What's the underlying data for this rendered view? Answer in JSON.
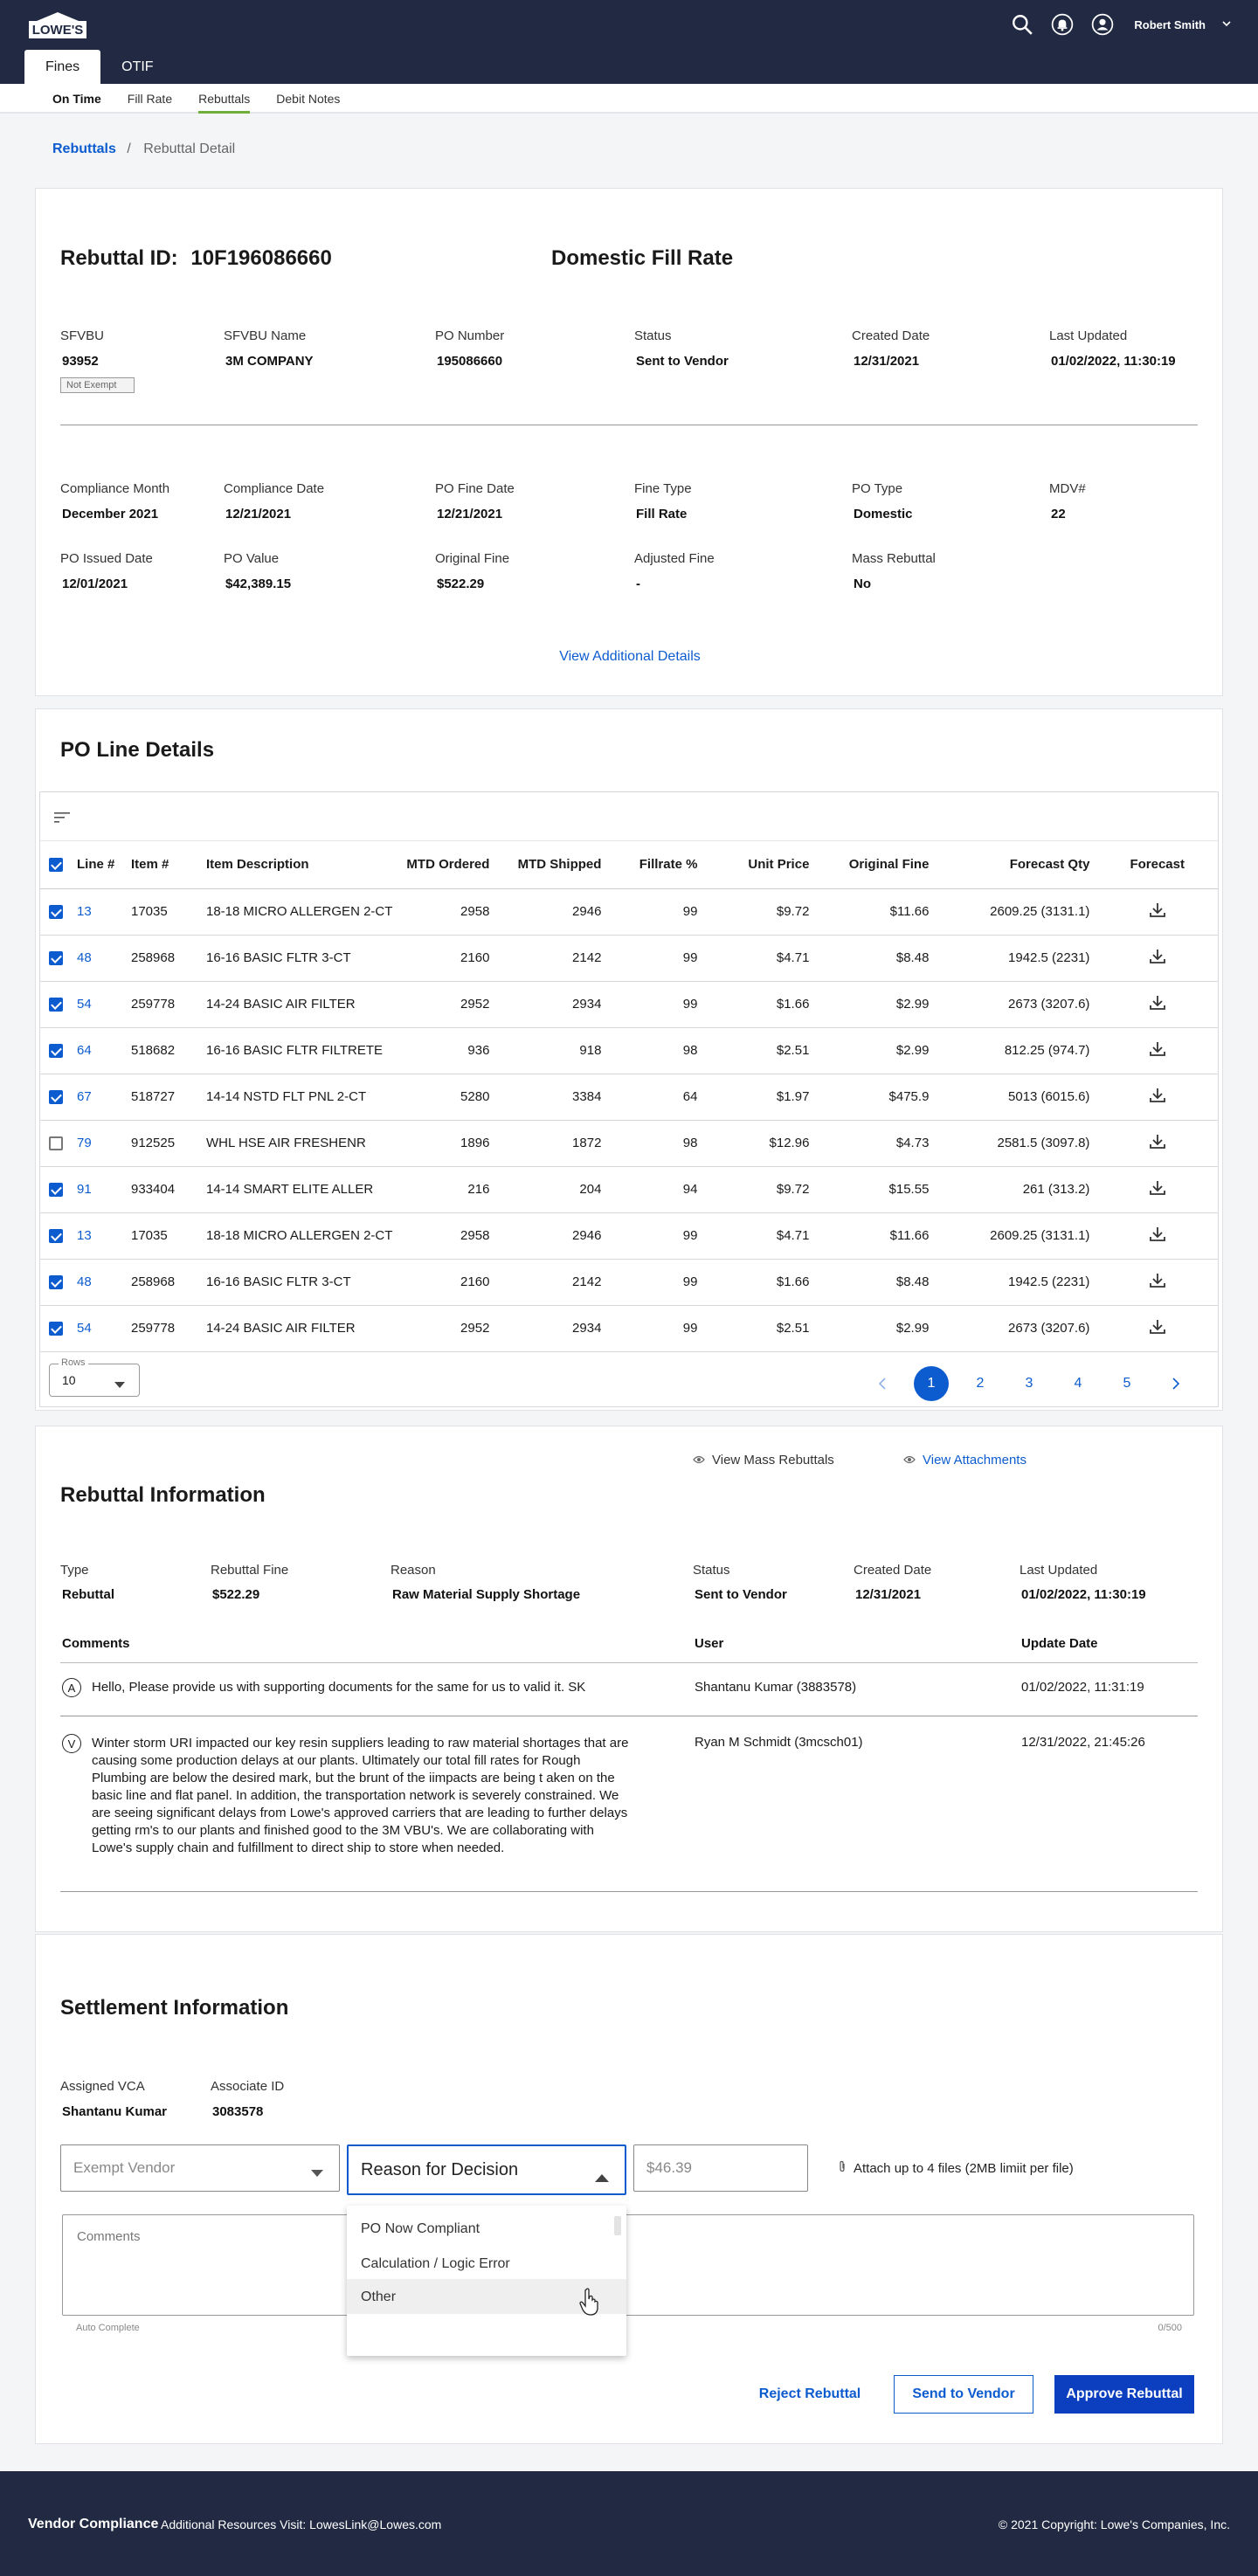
{
  "header": {
    "logo_text": "LOWE'S",
    "user_name": "Robert Smith",
    "tabs": [
      {
        "label": "Fines",
        "active": true
      },
      {
        "label": "OTIF",
        "active": false
      }
    ]
  },
  "subnav": [
    "On Time",
    "Fill Rate",
    "Rebuttals",
    "Debit Notes"
  ],
  "breadcrumb": {
    "root": "Rebuttals",
    "sep": "/",
    "current": "Rebuttal Detail"
  },
  "detail": {
    "id_label": "Rebuttal ID:",
    "id_value": "10F196086660",
    "type_title": "Domestic Fill Rate",
    "row1": [
      {
        "label": "SFVBU",
        "value": "93952"
      },
      {
        "label": "SFVBU Name",
        "value": "3M COMPANY"
      },
      {
        "label": "PO Number",
        "value": "195086660"
      },
      {
        "label": "Status",
        "value": "Sent to Vendor"
      },
      {
        "label": "Created Date",
        "value": "12/31/2021"
      },
      {
        "label": "Last Updated",
        "value": "01/02/2022, 11:30:19"
      }
    ],
    "exempt_chip": "Not Exempt",
    "row2": [
      {
        "label": "Compliance Month",
        "value": "December 2021"
      },
      {
        "label": "Compliance Date",
        "value": "12/21/2021"
      },
      {
        "label": "PO Fine Date",
        "value": "12/21/2021"
      },
      {
        "label": "Fine Type",
        "value": "Fill Rate"
      },
      {
        "label": "PO Type",
        "value": "Domestic"
      },
      {
        "label": "MDV#",
        "value": "22"
      }
    ],
    "row3": [
      {
        "label": "PO Issued Date",
        "value": "12/01/2021"
      },
      {
        "label": "PO Value",
        "value": "$42,389.15"
      },
      {
        "label": "Original Fine",
        "value": "$522.29"
      },
      {
        "label": "Adjusted Fine",
        "value": "-"
      },
      {
        "label": "Mass Rebuttal",
        "value": "No"
      }
    ],
    "view_more": "View Additional Details"
  },
  "po_lines": {
    "title": "PO Line Details",
    "columns": [
      "Line #",
      "Item #",
      "Item Description",
      "MTD Ordered",
      "MTD Shipped",
      "Fillrate %",
      "Unit Price",
      "Original Fine",
      "Forecast Qty",
      "Forecast"
    ],
    "rows": [
      {
        "checked": true,
        "line": "13",
        "item": "17035",
        "desc": "18-18 MICRO ALLERGEN 2-CT",
        "ordered": "2958",
        "shipped": "2946",
        "fill": "99",
        "price": "$9.72",
        "fine": "$11.66",
        "fq": "2609.25 (3131.1)"
      },
      {
        "checked": true,
        "line": "48",
        "item": "258968",
        "desc": "16-16 BASIC FLTR 3-CT",
        "ordered": "2160",
        "shipped": "2142",
        "fill": "99",
        "price": "$4.71",
        "fine": "$8.48",
        "fq": "1942.5 (2231)"
      },
      {
        "checked": true,
        "line": "54",
        "item": "259778",
        "desc": "14-24 BASIC AIR FILTER",
        "ordered": "2952",
        "shipped": "2934",
        "fill": "99",
        "price": "$1.66",
        "fine": "$2.99",
        "fq": "2673 (3207.6)"
      },
      {
        "checked": true,
        "line": "64",
        "item": "518682",
        "desc": "16-16 BASIC FLTR FILTRETE",
        "ordered": "936",
        "shipped": "918",
        "fill": "98",
        "price": "$2.51",
        "fine": "$2.99",
        "fq": "812.25 (974.7)"
      },
      {
        "checked": true,
        "line": "67",
        "item": "518727",
        "desc": "14-14 NSTD FLT PNL 2-CT",
        "ordered": "5280",
        "shipped": "3384",
        "fill": "64",
        "price": "$1.97",
        "fine": "$475.9",
        "fq": "5013 (6015.6)"
      },
      {
        "checked": false,
        "line": "79",
        "item": "912525",
        "desc": "WHL HSE AIR FRESHENR",
        "ordered": "1896",
        "shipped": "1872",
        "fill": "98",
        "price": "$12.96",
        "fine": "$4.73",
        "fq": "2581.5 (3097.8)"
      },
      {
        "checked": true,
        "line": "91",
        "item": "933404",
        "desc": "14-14 SMART ELITE ALLER",
        "ordered": "216",
        "shipped": "204",
        "fill": "94",
        "price": "$9.72",
        "fine": "$15.55",
        "fq": "261 (313.2)"
      },
      {
        "checked": true,
        "line": "13",
        "item": "17035",
        "desc": "18-18 MICRO ALLERGEN 2-CT",
        "ordered": "2958",
        "shipped": "2946",
        "fill": "99",
        "price": "$4.71",
        "fine": "$11.66",
        "fq": "2609.25 (3131.1)"
      },
      {
        "checked": true,
        "line": "48",
        "item": "258968",
        "desc": "16-16 BASIC FLTR 3-CT",
        "ordered": "2160",
        "shipped": "2142",
        "fill": "99",
        "price": "$1.66",
        "fine": "$8.48",
        "fq": "1942.5 (2231)"
      },
      {
        "checked": true,
        "line": "54",
        "item": "259778",
        "desc": "14-24 BASIC AIR FILTER",
        "ordered": "2952",
        "shipped": "2934",
        "fill": "99",
        "price": "$2.51",
        "fine": "$2.99",
        "fq": "2673 (3207.6)"
      }
    ],
    "rows_label": "Rows",
    "rows_value": "10",
    "pages": [
      "1",
      "2",
      "3",
      "4",
      "5"
    ],
    "current_page": "1"
  },
  "rebuttal": {
    "title": "Rebuttal Information",
    "view_mass": "View Mass Rebuttals",
    "view_attach": "View Attachments",
    "fields": [
      {
        "label": "Type",
        "value": "Rebuttal"
      },
      {
        "label": "Rebuttal Fine",
        "value": "$522.29"
      },
      {
        "label": "Reason",
        "value": "Raw Material Supply Shortage"
      },
      {
        "label": "Status",
        "value": "Sent to Vendor"
      },
      {
        "label": "Created Date",
        "value": "12/31/2021"
      },
      {
        "label": "Last Updated",
        "value": "01/02/2022, 11:30:19"
      }
    ],
    "comment_headers": [
      "Comments",
      "User",
      "Update Date"
    ],
    "comments": [
      {
        "avatar": "A",
        "text": "Hello, Please provide us with supporting documents for the same for us to valid it.  SK",
        "user": "Shantanu Kumar (3883578)",
        "date": "01/02/2022, 11:31:19"
      },
      {
        "avatar": "V",
        "text": "Winter storm URI impacted our key resin suppliers leading to raw material shortages that are causing some production delays at our plants.  Ultimately our total fill rates for Rough Plumbing are below the desired mark, but the brunt of the iimpacts are being t aken on the basic line and flat panel.  In addition, the transportation network is severely constrained.  We are seeing significant delays from Lowe's approved carriers that are leading to further delays getting rm's to our plants and finished good to the 3M VBU's.  We are collaborating with Lowe's supply chain and fulfillment to direct ship to store when needed.",
        "user": "Ryan M Schmidt (3mcsch01)",
        "date": "12/31/2022, 21:45:26"
      }
    ]
  },
  "settlement": {
    "title": "Settlement Information",
    "fields": [
      {
        "label": "Assigned VCA",
        "value": "Shantanu Kumar"
      },
      {
        "label": "Associate ID",
        "value": "3083578"
      }
    ],
    "exempt_placeholder": "Exempt Vendor",
    "reason_label": "Reason for Decision",
    "amount_placeholder": "$46.39",
    "attach_text": "Attach up to 4 files (2MB limiit per file)",
    "comments_placeholder": "Comments",
    "auto_complete": "Auto Complete",
    "char_count": "0/500",
    "dropdown_options": [
      "PO Now Compliant",
      "Calculation / Logic Error",
      "Other"
    ],
    "reject": "Reject Rebuttal",
    "send": "Send to Vendor",
    "approve": "Approve Rebuttal"
  },
  "footer": {
    "brand": "Vendor Compliance",
    "resources": "Additional Resources Visit: LowesLink@Lowes.com",
    "copyright": "© 2021 Copyright: Lowe's Companies, Inc."
  },
  "colors": {
    "navy": "#212a42",
    "blue": "#0c5ccf",
    "green": "#6fae3a"
  }
}
